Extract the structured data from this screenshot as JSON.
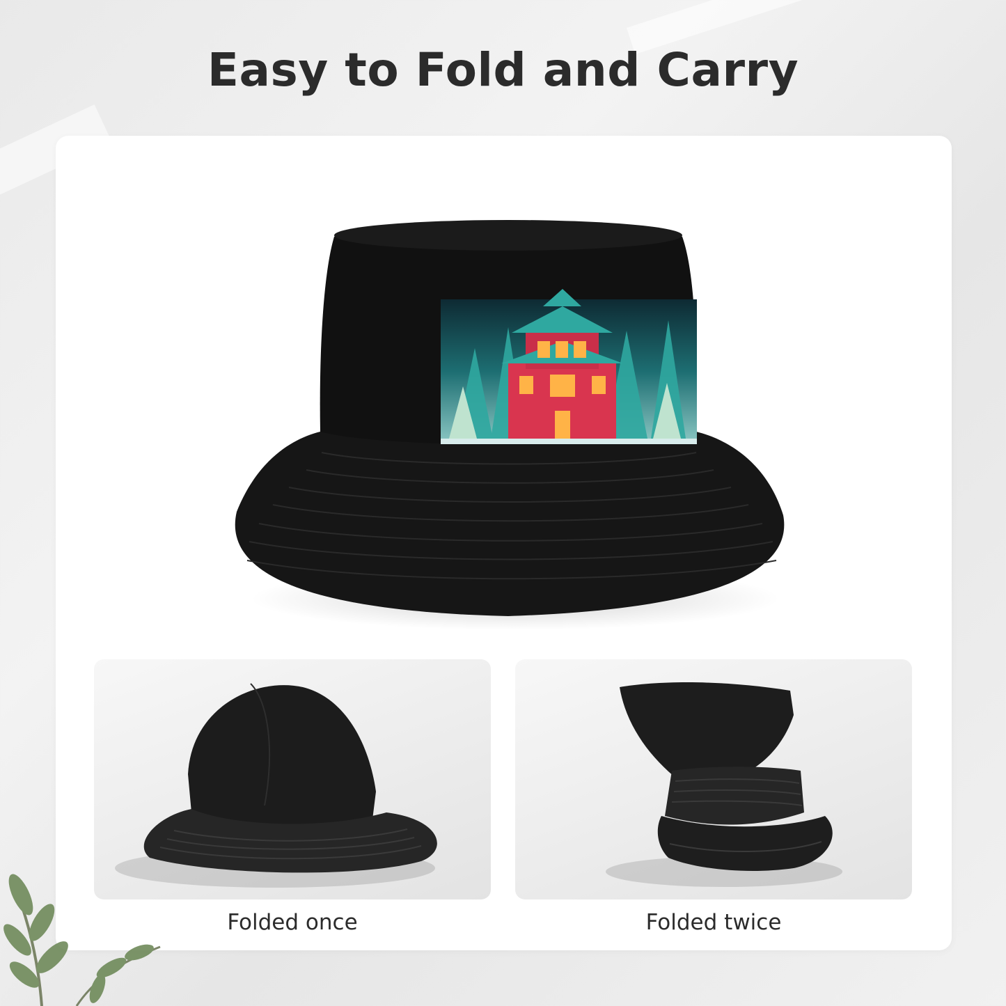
{
  "heading": "Easy to Fold and Carry",
  "panels": [
    {
      "caption": "Folded once",
      "icon": "hat-folded-once-photo"
    },
    {
      "caption": "Folded twice",
      "icon": "hat-folded-twice-photo"
    }
  ],
  "main_image": {
    "icon": "bucket-hat-house-print-photo"
  },
  "colors": {
    "heading": "#2b2b2b",
    "card": "#ffffff",
    "hat": "#141414",
    "print_teal": "#2fa8a0",
    "print_house": "#d9354f"
  }
}
